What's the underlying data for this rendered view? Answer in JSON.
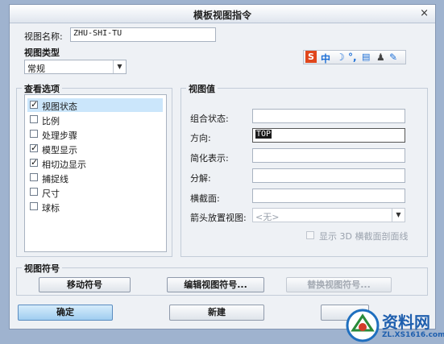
{
  "dialog": {
    "title": "模板视图指令",
    "close_glyph": "×"
  },
  "view_name": {
    "label": "视图名称:",
    "value": "ZHU-SHI-TU"
  },
  "view_type": {
    "title": "视图类型",
    "selected": "常规"
  },
  "ime_toolbar": {
    "s_logo": "S",
    "mode": "中",
    "icons": [
      "moon-icon",
      "punctuation-icon",
      "keyboard-icon",
      "user-icon",
      "wrench-icon"
    ],
    "colors": {
      "s": "#e0461c",
      "mode": "#1d6fd6"
    }
  },
  "view_options": {
    "title": "查看选项",
    "items": [
      {
        "label": "视图状态",
        "checked": true,
        "selected": true
      },
      {
        "label": "比例",
        "checked": false,
        "selected": false
      },
      {
        "label": "处理步骤",
        "checked": false,
        "selected": false
      },
      {
        "label": "模型显示",
        "checked": true,
        "selected": false
      },
      {
        "label": "相切边显示",
        "checked": true,
        "selected": false
      },
      {
        "label": "捕捉线",
        "checked": false,
        "selected": false
      },
      {
        "label": "尺寸",
        "checked": false,
        "selected": false
      },
      {
        "label": "球标",
        "checked": false,
        "selected": false
      }
    ]
  },
  "view_values": {
    "title": "视图值",
    "combined_state": {
      "label": "组合状态:",
      "value": ""
    },
    "orientation": {
      "label": "方向:",
      "value": "TOP"
    },
    "simplified_rep": {
      "label": "简化表示:",
      "value": ""
    },
    "explode": {
      "label": "分解:",
      "value": ""
    },
    "cross_section": {
      "label": "横截面:",
      "value": ""
    },
    "arrow_view": {
      "label": "箭头放置视图:",
      "value": "<无>"
    },
    "show_3d_section": {
      "label": "显示 3D 横截面剖面线"
    }
  },
  "view_symbol": {
    "title": "视图符号",
    "move_label": "移动符号",
    "edit_label": "编辑视图符号...",
    "replace_label": "替换视图符号..."
  },
  "footer": {
    "ok_label": "确定",
    "new_label": "新建"
  },
  "watermark": {
    "brand": "资料网",
    "url": "ZL.XS1616.com"
  }
}
